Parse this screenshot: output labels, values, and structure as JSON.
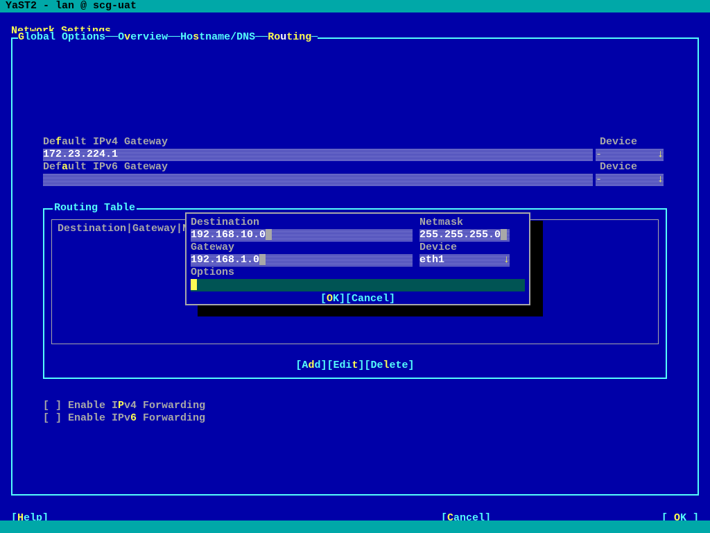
{
  "title": "YaST2 - lan @ scg-uat",
  "page_title": "Network Settings",
  "tabs": {
    "global": "Global Options",
    "overview": "Overview",
    "hostname": "Hostname/DNS",
    "routing": "Routing"
  },
  "labels": {
    "def_ipv4_gw": "Default IPv4 Gateway",
    "def_ipv6_gw": "Default IPv6 Gateway",
    "device": "Device",
    "routing_table": "Routing Table",
    "table_header": "Destination|Gateway|Net",
    "enable_ipv4_fw": "[ ] Enable IPv4 Forwarding",
    "enable_ipv6_fw": "[ ] Enable IPv6 Forwarding",
    "empty_dev": "-"
  },
  "values": {
    "ipv4_gw": "172.23.224.1",
    "ipv6_gw": ""
  },
  "dialog": {
    "dest_label": "Destination",
    "netmask_label": "Netmask",
    "gateway_label": "Gateway",
    "device_label": "Device",
    "options_label": "Options",
    "dest": "192.168.10.0",
    "netmask": "255.255.255.0",
    "gateway": "192.168.1.0",
    "device": "eth1",
    "ok": "[OK]",
    "cancel": "[Cancel]"
  },
  "rt_buttons": {
    "add": "[Add]",
    "edit": "[Edit]",
    "delete": "[Delete]"
  },
  "bottom": {
    "help": "[Help]",
    "cancel": "[Cancel]",
    "ok": "[ OK ]"
  }
}
